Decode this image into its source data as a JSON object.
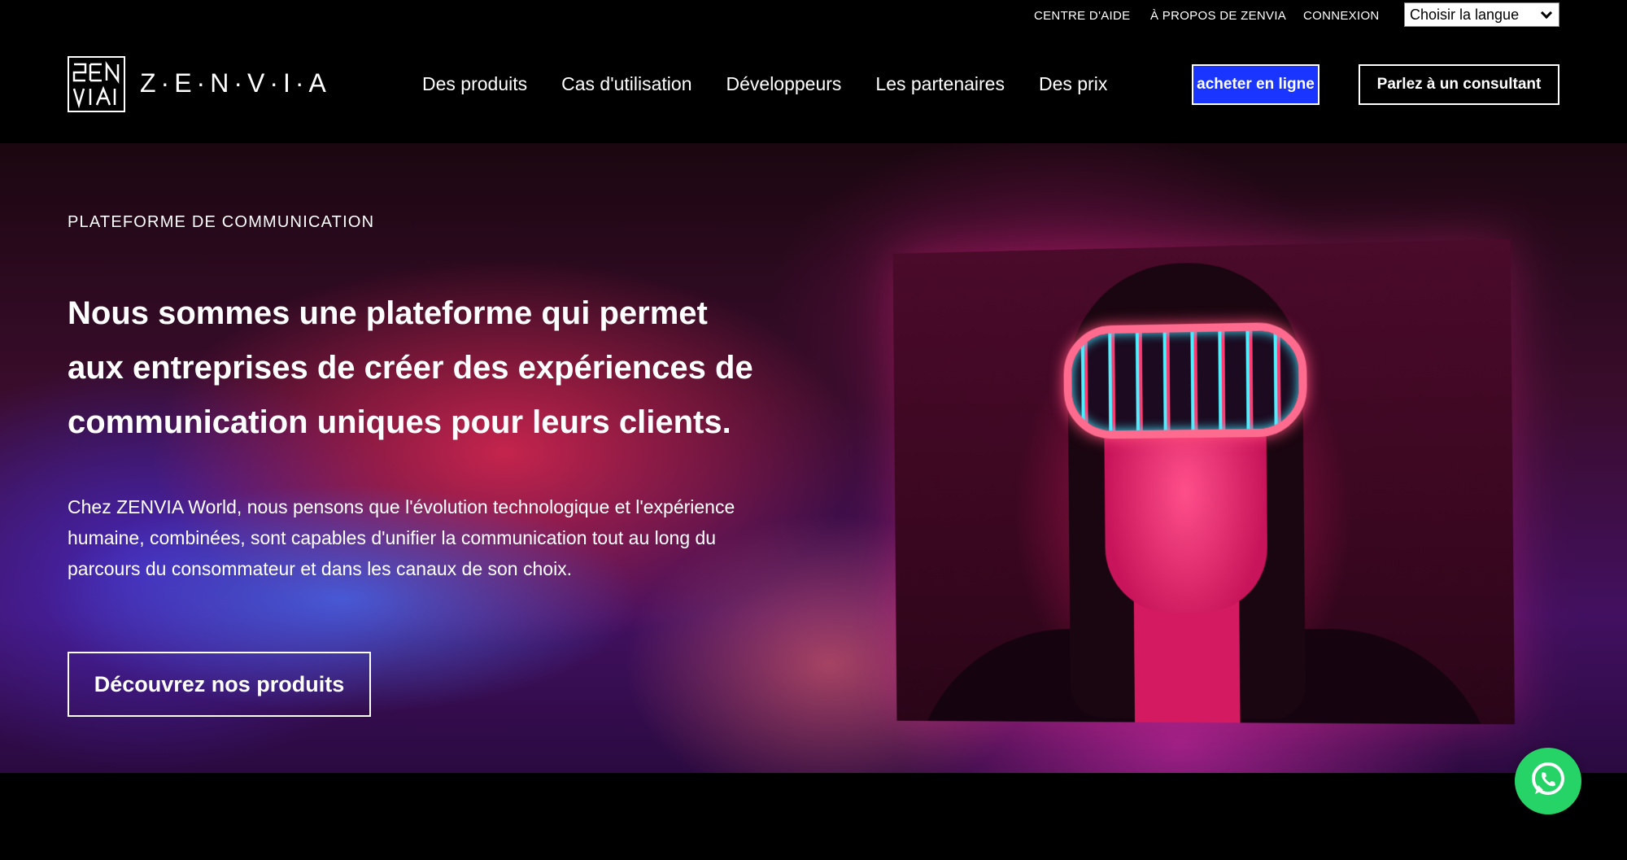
{
  "topbar": {
    "help": "CENTRE D'AIDE",
    "about": "À PROPOS DE ZENVIA",
    "login": "CONNEXION",
    "language_select": "Choisir la langue"
  },
  "header": {
    "logo_text": "Z·E·N·V·I·A",
    "nav": [
      "Des produits",
      "Cas d'utilisation",
      "Développeurs",
      "Les partenaires",
      "Des prix"
    ],
    "buy_button": "acheter en ligne",
    "consult_button": "Parlez à un consultant",
    "accent_color": "#1a35ff"
  },
  "hero": {
    "eyebrow": "PLATEFORME DE COMMUNICATION",
    "headline": "Nous sommes une plateforme qui permet aux entreprises de créer des expériences de communication uniques pour leurs clients.",
    "intro": "Chez ZENVIA World, nous pensons que l'évolution technologique et l'expérience humaine, combinées, sont capables d'unifier la communication tout au long du parcours du consommateur et dans les canaux de son choix.",
    "cta": "Découvrez nos produits"
  },
  "floating": {
    "whatsapp_icon": "whatsapp-icon",
    "whatsapp_color": "#25d366"
  }
}
